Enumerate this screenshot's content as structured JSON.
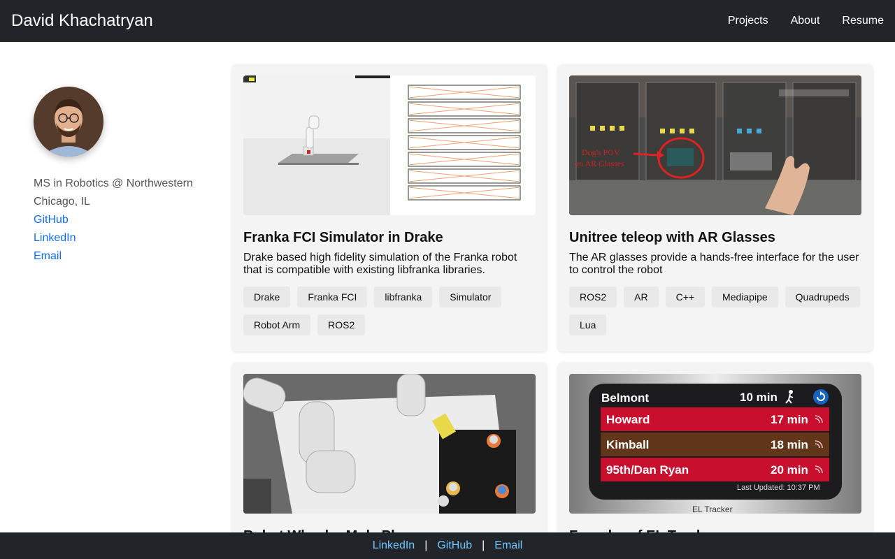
{
  "nav": {
    "brand": "David Khachatryan",
    "links": [
      "Projects",
      "About",
      "Resume"
    ]
  },
  "profile": {
    "line1": "MS in Robotics @ Northwestern",
    "line2": "Chicago, IL",
    "links": [
      "GitHub",
      "LinkedIn",
      "Email"
    ]
  },
  "projects": [
    {
      "title": "Franka FCI Simulator in Drake",
      "description": "Drake based high fidelity simulation of the Franka robot that is compatible with existing libfranka libraries.",
      "tags": [
        "Drake",
        "Franka FCI",
        "libfranka",
        "Simulator",
        "Robot Arm",
        "ROS2"
      ]
    },
    {
      "title": "Unitree teleop with AR Glasses",
      "description": "The AR glasses provide a hands-free interface for the user to control the robot",
      "tags": [
        "ROS2",
        "AR",
        "C++",
        "Mediapipe",
        "Quadrupeds",
        "Lua"
      ],
      "image_text": {
        "annotation_line1": "Dog's POV",
        "annotation_line2": "on AR Glasses"
      }
    },
    {
      "title": "Robot Wheeler Mole Play",
      "description": "",
      "tags": []
    },
    {
      "title": "Founder of EL Tracker",
      "description": "",
      "tags": [],
      "widget": {
        "station": "Belmont",
        "walk_time": "10 min",
        "arrivals": [
          {
            "dest": "Howard",
            "time": "17 min",
            "color": "#c8102e"
          },
          {
            "dest": "Kimball",
            "time": "18 min",
            "color": "#62361b"
          },
          {
            "dest": "95th/Dan Ryan",
            "time": "20 min",
            "color": "#c8102e"
          }
        ],
        "updated": "Last Updated: 10:37 PM",
        "app_name": "EL Tracker"
      }
    }
  ],
  "footer": {
    "links": [
      "LinkedIn",
      "GitHub",
      "Email"
    ],
    "separator": "|"
  },
  "colors": {
    "nav_bg": "#212529",
    "link": "#0d6efd",
    "footer_link": "#6ec6ff",
    "card_bg": "#f4f4f4",
    "tag_bg": "#e9e9e9"
  }
}
